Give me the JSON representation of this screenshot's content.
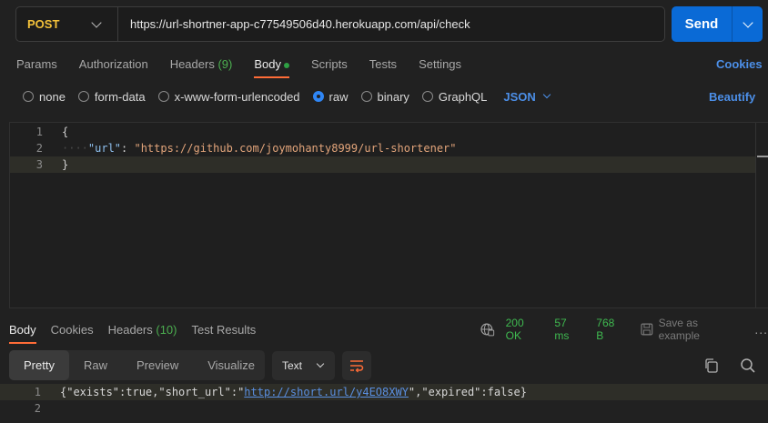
{
  "request": {
    "method": "POST",
    "url": "https://url-shortner-app-c77549506d40.herokuapp.com/api/check",
    "send_label": "Send"
  },
  "request_tabs": [
    {
      "label": "Params"
    },
    {
      "label": "Authorization"
    },
    {
      "label": "Headers",
      "count": "(9)"
    },
    {
      "label": "Body",
      "active": true
    },
    {
      "label": "Scripts"
    },
    {
      "label": "Tests"
    },
    {
      "label": "Settings"
    }
  ],
  "cookies_label": "Cookies",
  "body_types": [
    "none",
    "form-data",
    "x-www-form-urlencoded",
    "raw",
    "binary",
    "GraphQL"
  ],
  "body_type_selected": "raw",
  "language": "JSON",
  "beautify_label": "Beautify",
  "editor": {
    "line_numbers": [
      "1",
      "2",
      "3"
    ],
    "open_brace": "{",
    "key": "\"url\"",
    "colon": ": ",
    "value": "\"https://github.com/joymohanty8999/url-shortener\"",
    "close_brace": "}"
  },
  "response_tabs": [
    {
      "label": "Body",
      "active": true
    },
    {
      "label": "Cookies"
    },
    {
      "label": "Headers",
      "count": "(10)"
    },
    {
      "label": "Test Results"
    }
  ],
  "response_status": {
    "code": "200 OK",
    "time": "57 ms",
    "size": "768 B",
    "save_label": "Save as example",
    "more": "..."
  },
  "view_modes": [
    "Pretty",
    "Raw",
    "Preview",
    "Visualize"
  ],
  "view_selected": "Pretty",
  "format": "Text",
  "response_body": {
    "line_numbers": [
      "1",
      "2"
    ],
    "prefix": "{\"exists\":true,\"short_url\":\"",
    "link": "http://short.url/y4EO8XWY",
    "suffix": "\",\"expired\":false}"
  },
  "colors": {
    "accent": "#ff6c37",
    "primary": "#0a6ad6",
    "method": "#f3c13a",
    "link": "#4c8fe8",
    "status_ok": "#3fb950"
  }
}
